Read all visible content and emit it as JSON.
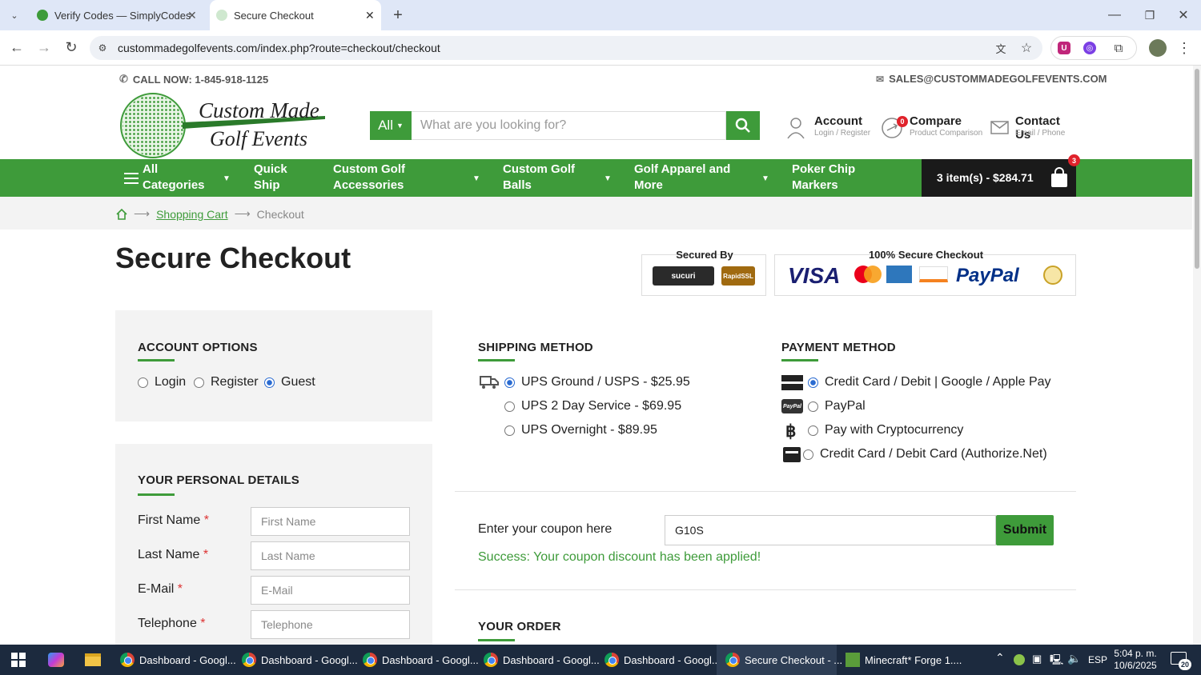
{
  "browser": {
    "tabs": [
      {
        "title": "Verify Codes — SimplyCodes"
      },
      {
        "title": "Secure Checkout"
      }
    ],
    "url": "custommadegolfevents.com/index.php?route=checkout/checkout"
  },
  "header": {
    "phone": "CALL NOW: 1-845-918-1125",
    "email": "SALES@CUSTOMMADEGOLFEVENTS.COM",
    "logo_line1": "Custom Made",
    "logo_line2": "Golf Events",
    "search_category": "All",
    "search_placeholder": "What are you looking for?",
    "account": {
      "label": "Account",
      "sub": "Login / Register"
    },
    "compare": {
      "label": "Compare",
      "sub": "Product Comparison",
      "count": "0"
    },
    "contact": {
      "label": "Contact Us",
      "sub": "Email / Phone"
    }
  },
  "nav": {
    "items": [
      {
        "label": "All Categories"
      },
      {
        "label": "Quick Ship"
      },
      {
        "label": "Custom Golf Accessories"
      },
      {
        "label": "Custom Golf Balls"
      },
      {
        "label": "Golf Apparel and More"
      },
      {
        "label": "Poker Chip Markers"
      }
    ],
    "cart_text": "3 item(s) - $284.71",
    "cart_count": "3"
  },
  "breadcrumb": {
    "link": "Shopping Cart",
    "current": "Checkout"
  },
  "page": {
    "title": "Secure Checkout",
    "secured_by": "Secured By",
    "secure_checkout": "100% Secure Checkout",
    "sucuri": "sucuri",
    "rapidssl": "RapidSSL",
    "visa": "VISA",
    "paypal_logo": "PayPal"
  },
  "account_options": {
    "heading": "ACCOUNT OPTIONS",
    "options": [
      {
        "label": "Login",
        "selected": false
      },
      {
        "label": "Register",
        "selected": false
      },
      {
        "label": "Guest",
        "selected": true
      }
    ]
  },
  "personal_details": {
    "heading": "YOUR PERSONAL DETAILS",
    "fields": [
      {
        "label": "First Name",
        "placeholder": "First Name"
      },
      {
        "label": "Last Name",
        "placeholder": "Last Name"
      },
      {
        "label": "E-Mail",
        "placeholder": "E-Mail"
      },
      {
        "label": "Telephone",
        "placeholder": "Telephone"
      }
    ]
  },
  "shipping": {
    "heading": "SHIPPING METHOD",
    "options": [
      {
        "label": "UPS Ground / USPS - $25.95",
        "selected": true
      },
      {
        "label": "UPS 2 Day Service - $69.95",
        "selected": false
      },
      {
        "label": "UPS Overnight - $89.95",
        "selected": false
      }
    ]
  },
  "payment": {
    "heading": "PAYMENT METHOD",
    "options": [
      {
        "label": "Credit Card / Debit | Google / Apple Pay",
        "selected": true
      },
      {
        "label": "PayPal",
        "selected": false
      },
      {
        "label": "Pay with Cryptocurrency",
        "selected": false
      },
      {
        "label": "Credit Card / Debit Card (Authorize.Net)",
        "selected": false
      }
    ]
  },
  "coupon": {
    "label": "Enter your coupon here",
    "value": "G10S",
    "submit": "Submit",
    "success": "Success: Your coupon discount has been applied!"
  },
  "order": {
    "heading": "YOUR ORDER"
  },
  "taskbar": {
    "items": [
      "Dashboard - Googl...",
      "Dashboard - Googl...",
      "Dashboard - Googl...",
      "Dashboard - Googl...",
      "Dashboard - Googl...",
      "Secure Checkout - ...",
      "Minecraft* Forge 1...."
    ],
    "lang": "ESP",
    "time": "5:04 p. m.",
    "date": "10/6/2025",
    "notif": "20"
  },
  "colors": {
    "brand_green": "#3e9b3a",
    "cart_dark": "#1a1a1a"
  }
}
